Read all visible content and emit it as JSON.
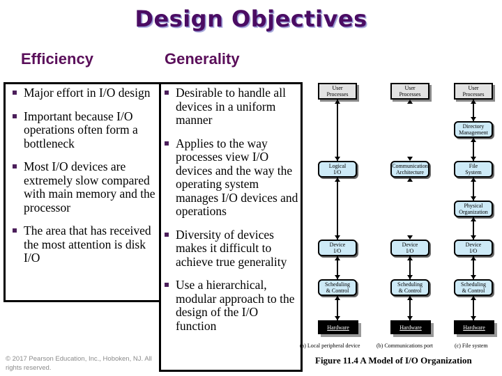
{
  "slide": {
    "title": "Design Objectives",
    "colors": {
      "title": "#4b0c63",
      "heading": "#5a0f5a",
      "bullet": "#4b1e5a",
      "layer_fill": "#cdeaf7"
    }
  },
  "columns": {
    "left": {
      "heading": "Efficiency",
      "bullets": [
        "Major effort in I/O design",
        "Important because I/O operations often form a bottleneck",
        "Most I/O devices are extremely slow compared with main memory and the processor",
        "The area that has received the most attention is disk I/O"
      ]
    },
    "right": {
      "heading": "Generality",
      "bullets": [
        "Desirable to handle all devices in a uniform manner",
        "Applies to the way processes view I/O devices and the way the operating system manages I/O devices and operations",
        "Diversity of devices makes it difficult to achieve true generality",
        "Use a hierarchical, modular approach to the design of the I/O function"
      ]
    }
  },
  "copyright": "© 2017 Pearson Education, Inc., Hoboken, NJ. All rights reserved.",
  "figure": {
    "caption": "Figure 11.4   A Model of I/O Organization",
    "stacks": [
      {
        "sublabel": "(a) Local peripheral device",
        "nodes": [
          "User\nProcesses",
          "Logical\nI/O",
          "Device\nI/O",
          "Scheduling\n& Control",
          "Hardware"
        ]
      },
      {
        "sublabel": "(b) Communications port",
        "nodes": [
          "User\nProcesses",
          "Communication\nArchitecture",
          "Device\nI/O",
          "Scheduling\n& Control",
          "Hardware"
        ]
      },
      {
        "sublabel": "(c) File system",
        "nodes": [
          "User\nProcesses",
          "Directory\nManagement",
          "File\nSystem",
          "Physical\nOrganization",
          "Device\nI/O",
          "Scheduling\n& Control",
          "Hardware"
        ]
      }
    ]
  }
}
